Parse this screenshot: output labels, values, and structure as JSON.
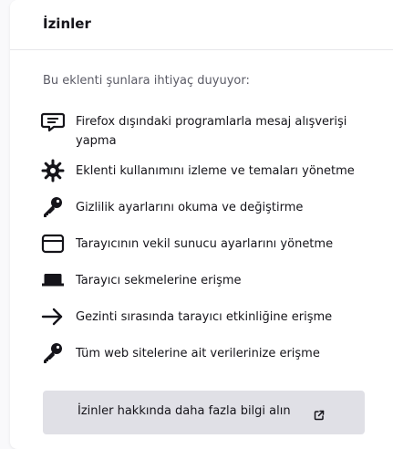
{
  "panel": {
    "title": "İzinler",
    "intro": "Bu eklenti şunlara ihtiyaç duyuyor:"
  },
  "permissions": [
    {
      "icon": "message-icon",
      "label": "Firefox dışındaki programlarla mesaj alışverişi yapma"
    },
    {
      "icon": "gear-icon",
      "label": "Eklenti kullanımını izleme ve temaları yönetme"
    },
    {
      "icon": "key-icon",
      "label": "Gizlilik ayarlarını okuma ve değiştirme"
    },
    {
      "icon": "window-icon",
      "label": "Tarayıcının vekil sunucu ayarlarını yönetme"
    },
    {
      "icon": "tab-icon",
      "label": "Tarayıcı sekmelerine erişme"
    },
    {
      "icon": "arrow-right-icon",
      "label": "Gezinti sırasında tarayıcı etkinliğine erişme"
    },
    {
      "icon": "key-icon",
      "label": "Tüm web sitelerine ait verilerinize erişme"
    }
  ],
  "learn_more": {
    "label": "İzinler hakkında daha fazla bilgi alın",
    "icon": "external-link-icon"
  }
}
